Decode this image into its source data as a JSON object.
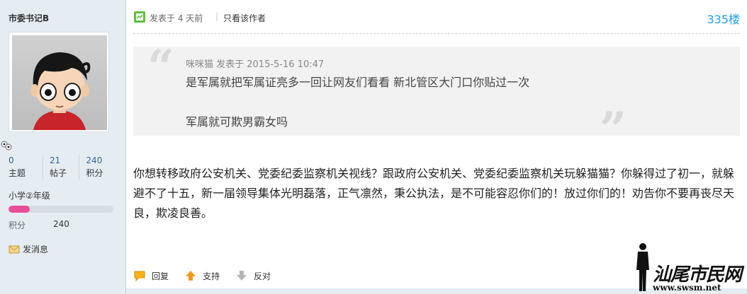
{
  "user": {
    "name": "市委书记B",
    "stats": [
      {
        "value": "0",
        "label": "主题"
      },
      {
        "value": "21",
        "label": "帖子"
      },
      {
        "value": "240",
        "label": "积分"
      }
    ],
    "level": "小学②年级",
    "level_progress": 0.2,
    "score_label": "积分",
    "score_value": "240",
    "send_message": "发消息"
  },
  "post": {
    "posted_at": "发表于 4 天前",
    "separator": "|",
    "only_author": "只看该作者",
    "floor": "335楼",
    "quote": {
      "meta": "咪咪猫 发表于 2015-5-16 10:47",
      "line1": "是军属就把军属证亮多一回让网友们看看    新北管区大门口你贴过一次",
      "line2": "军属就可欺男霸女吗"
    },
    "body": "你想转移政府公安机关、党委纪委监察机关视线？跟政府公安机关、党委纪委监察机关玩躲猫猫？你躲得过了初一，就躲避不了十五，新一届领导集体光明磊落，正气凛然，秉公执法，是不可能容忍你们的！放过你们的！劝告你不要再丧尽天良，欺凌良善。",
    "actions": {
      "reply": "回复",
      "support": "支持",
      "oppose": "反对"
    }
  },
  "watermark": {
    "name": "汕尾市民网",
    "url": "www.swsm.net"
  },
  "colors": {
    "accent": "#1e9fe8",
    "panel": "#e5edf2",
    "level_fill": "#e84f9a"
  }
}
